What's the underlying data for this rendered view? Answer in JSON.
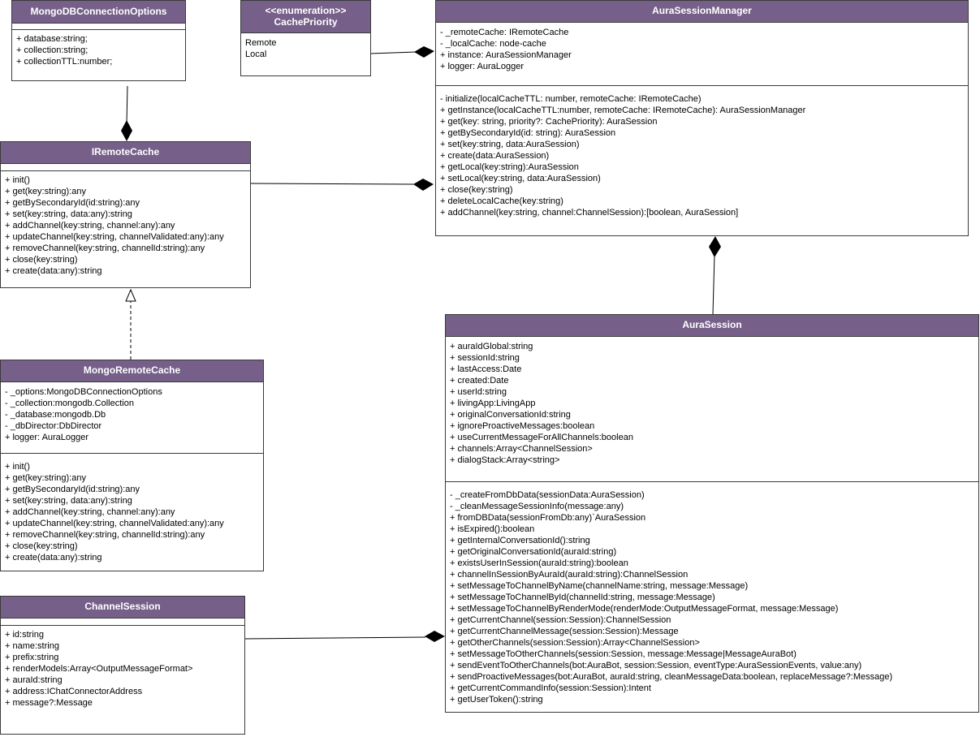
{
  "classes": {
    "mongo_options": {
      "name": "MongoDBConnectionOptions",
      "attributes": [
        "+ database:string;",
        "+ collection:string;",
        "+ collectionTTL:number;"
      ],
      "methods": []
    },
    "cache_priority": {
      "stereotype": "<<enumeration>>",
      "name": "CachePriority",
      "values": [
        "Remote",
        "Local"
      ]
    },
    "session_manager": {
      "name": "AuraSessionManager",
      "attributes": [
        "- _remoteCache: IRemoteCache",
        "- _localCache: node-cache",
        "+ instance: AuraSessionManager",
        "+ logger: AuraLogger"
      ],
      "methods": [
        "- initialize(localCacheTTL: number, remoteCache: IRemoteCache)",
        "+ getInstance(localCacheTTL:number, remoteCache: IRemoteCache): AuraSessionManager",
        "+ get(key: string, priority?: CachePriority): AuraSession",
        "+ getBySecondaryId(id: string): AuraSession",
        "+ set(key:string, data:AuraSession)",
        "+ create(data:AuraSession)",
        "+ getLocal(key:string):AuraSession",
        "+ setLocal(key:string, data:AuraSession)",
        "+ close(key:string)",
        "+ deleteLocalCache(key:string)",
        "+ addChannel(key:string, channel:ChannelSession):[boolean, AuraSession]"
      ]
    },
    "iremote_cache": {
      "name": "IRemoteCache",
      "attributes": [],
      "methods": [
        "+ init()",
        "+ get(key:string):any",
        "+ getBySecondaryId(id:string):any",
        "+ set(key:string, data:any):string",
        "+ addChannel(key:string, channel:any):any",
        "+ updateChannel(key:string, channelValidated:any):any",
        "+ removeChannel(key:string, channelId:string):any",
        "+ close(key:string)",
        "+ create(data:any):string"
      ]
    },
    "mongo_remote_cache": {
      "name": "MongoRemoteCache",
      "attributes": [
        "- _options:MongoDBConnectionOptions",
        "- _collection:mongodb.Collection",
        "- _database:mongodb.Db",
        "- _dbDirector:DbDirector",
        "+ logger: AuraLogger"
      ],
      "methods": [
        "+ init()",
        "+ get(key:string):any",
        "+ getBySecondaryId(id:string):any",
        "+ set(key:string, data:any):string",
        "+ addChannel(key:string, channel:any):any",
        "+ updateChannel(key:string, channelValidated:any):any",
        "+ removeChannel(key:string, channelId:string):any",
        "+ close(key:string)",
        "+ create(data:any):string"
      ]
    },
    "aura_session": {
      "name": "AuraSession",
      "attributes": [
        "+ auraIdGlobal:string",
        "+ sessionId:string",
        "+ lastAccess:Date",
        "+ created:Date",
        "+ userId:string",
        "+ livingApp:LivingApp",
        "+ originalConversationId:string",
        "+ ignoreProactiveMessages:boolean",
        "+ useCurrentMessageForAllChannels:boolean",
        "+ channels:Array<ChannelSession>",
        "+ dialogStack:Array<string>"
      ],
      "methods": [
        "- _createFromDbData(sessionData:AuraSession)",
        "- _cleanMessageSessionInfo(message:any)",
        "+ fromDBData(sessionFromDb:any)`AuraSession",
        "+ isExpired():boolean",
        "+ getInternalConversationId():string",
        "+ getOriginalConversationId(auraId:string)",
        "+ existsUserInSession(auraId:string):boolean",
        "+ channelInSessionByAuraId(auraId:string):ChannelSession",
        "+ setMessageToChannelByName(channelName:string, message:Message)",
        "+ setMessageToChannelById(channelId:string, message:Message)",
        "+ setMessageToChannelByRenderMode(renderMode:OutputMessageFormat, message:Message)",
        "+ getCurrentChannel(session:Session):ChannelSession",
        "+ getCurrentChannelMessage(session:Session):Message",
        "+ getOtherChannels(session:Session):Array<ChannelSession>",
        "+ setMessageToOtherChannels(session:Session, message:Message|MessageAuraBot)",
        "+ sendEventToOtherChannels(bot:AuraBot, session:Session, eventType:AuraSessionEvents, value:any)",
        "+ sendProactiveMessages(bot:AuraBot, auraId:string, cleanMessageData:boolean, replaceMessage?:Message)",
        "+ getCurrentCommandInfo(session:Session):Intent",
        "+ getUserToken():string"
      ]
    },
    "channel_session": {
      "name": "ChannelSession",
      "attributes": [
        "+ id:string",
        "+ name:string",
        "+ prefix:string",
        "+ renderModels:Array<OutputMessageFormat>",
        "+ auraId:string",
        "+ address:IChatConnectorAddress",
        "+ message?:Message"
      ],
      "methods": []
    }
  },
  "colors": {
    "header": "#76608a",
    "border": "#3a3a3a",
    "line": "#000000"
  }
}
